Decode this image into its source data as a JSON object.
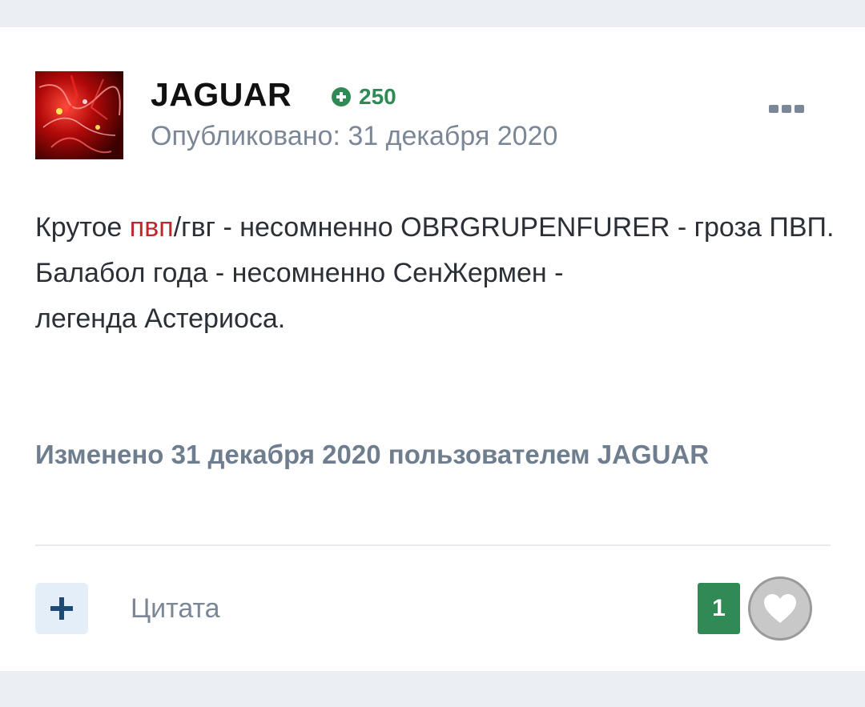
{
  "post": {
    "author": "JAGUAR",
    "reputation": "250",
    "published": "Опубликовано: 31 декабря 2020",
    "body": {
      "line1_prefix": "Крутое ",
      "line1_highlight": "пвп",
      "line1_suffix": "/гвг - несомненно OBRGRUPENFURER - гроза ПВП.",
      "line2": "Балабол года - несомненно СенЖермен - легенда Астериоса."
    },
    "edited": "Изменено 31 декабря 2020 пользователем JAGUAR"
  },
  "actions": {
    "quote_label": "Цитата",
    "like_count": "1"
  },
  "icons": {
    "reputation": "plus-circle-icon",
    "more": "ellipsis-icon",
    "add": "plus-icon",
    "like": "heart-icon"
  },
  "colors": {
    "page_bg": "#ebeef2",
    "card_bg": "#ffffff",
    "reputation": "#2f8a55",
    "muted": "#7b8796",
    "highlight": "#c0262d",
    "add_button_bg": "#e3eef8"
  }
}
